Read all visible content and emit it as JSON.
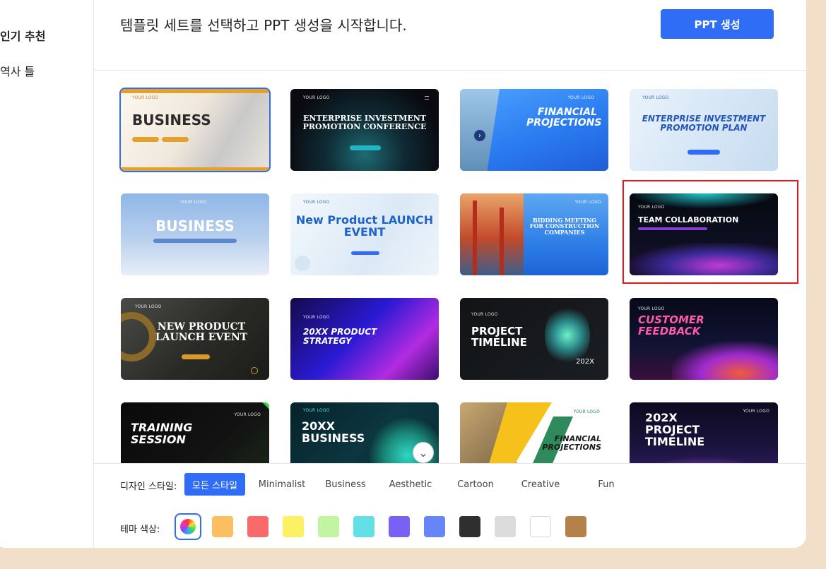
{
  "sidebar": {
    "items": [
      {
        "label": "인기 추천",
        "active": true
      },
      {
        "label": "역사 틀",
        "active": false
      }
    ]
  },
  "header": {
    "title": "템플릿 세트를 선택하고 PPT 생성을 시작합니다.",
    "generate_label": "PPT 생성"
  },
  "templates": [
    {
      "title": "BUSINESS",
      "logo": "YOUR LOGO"
    },
    {
      "title": "ENTERPRISE INVESTMENT PROMOTION CONFERENCE",
      "logo": "YOUR LOGO"
    },
    {
      "title": "FINANCIAL PROJECTIONS",
      "logo": "YOUR LOGO"
    },
    {
      "title": "ENTERPRISE INVESTMENT PROMOTION PLAN",
      "logo": "YOUR LOGO"
    },
    {
      "title": "BUSINESS",
      "logo": "YOUR LOGO"
    },
    {
      "title": "New Product LAUNCH EVENT",
      "logo": "YOUR LOGO"
    },
    {
      "title": "BIDDING MEETING FOR CONSTRUCTION COMPANIES",
      "logo": "YOUR LOGO"
    },
    {
      "title": "TEAM COLLABORATION",
      "logo": "YOUR LOGO"
    },
    {
      "title": "NEW PRODUCT LAUNCH EVENT",
      "logo": "YOUR LOGO"
    },
    {
      "title": "20XX PRODUCT STRATEGY",
      "logo": "YOUR LOGO"
    },
    {
      "title": "PROJECT TIMELINE",
      "logo": "YOUR LOGO",
      "year": "202X"
    },
    {
      "title": "CUSTOMER FEEDBACK",
      "logo": "YOUR LOGO"
    },
    {
      "title": "TRAINING SESSION",
      "logo": "YOUR LOGO"
    },
    {
      "title": "20XX BUSINESS",
      "logo": "YOUR LOGO"
    },
    {
      "title": "FINANCIAL PROJECTIONS",
      "logo": "YOUR LOGO"
    },
    {
      "title": "202X PROJECT TIMELINE",
      "logo": "YOUR LOGO"
    }
  ],
  "filters": {
    "style_label": "디자인 스타일:",
    "styles": [
      "모든 스타일",
      "Minimalist",
      "Business",
      "Aesthetic",
      "Cartoon",
      "Creative",
      "Fun"
    ],
    "color_label": "테마 색상:",
    "colors": [
      "rainbow",
      "#fbbf61",
      "#fb6a6a",
      "#fbf163",
      "#c1f5a1",
      "#62e0e5",
      "#7a61f5",
      "#6685f8",
      "#2f2f2f",
      "#dcdcdc",
      "#ffffff",
      "#b5814b"
    ]
  },
  "accent_color": "#2f6df6",
  "highlight_color": "#e8141b"
}
